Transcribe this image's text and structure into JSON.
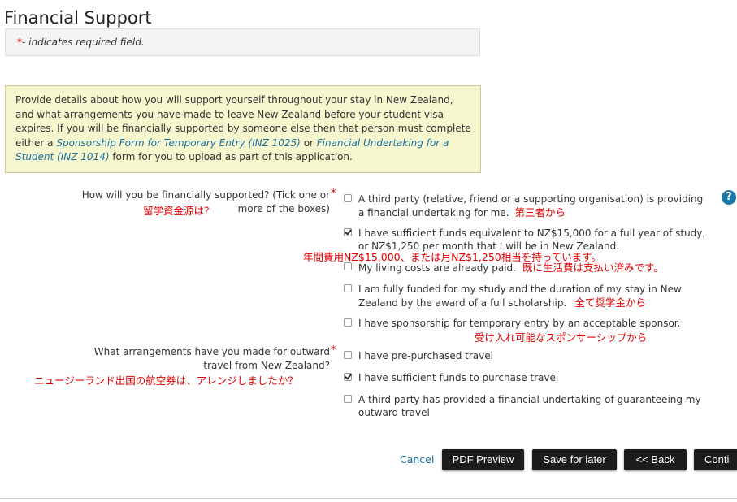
{
  "page": {
    "title": "Financial Support"
  },
  "required_note": {
    "star": "*",
    "text": "- indicates required field."
  },
  "info": {
    "text_before": "Provide details about how you will support yourself throughout your stay in New Zealand, and what arrangements you have made to leave New Zealand before your student visa expires. If you will be financially supported by someone else then that person must complete either a ",
    "link1": "Sponsorship Form for Temporary Entry (INZ 1025)",
    "text_mid": " or ",
    "link2": "Financial Undertaking for a Student (INZ 1014)",
    "text_after": " form for you to upload as part of this application."
  },
  "q1": {
    "label_line1": "How will you be financially supported? (Tick one or",
    "label_line2": "more of the boxes)",
    "star": "*",
    "annotation": "留学資金源は？",
    "options": [
      {
        "line1": "A third party (relative, friend or a supporting organisation) is providing",
        "line2": "a financial undertaking for me.",
        "checked": false,
        "annotation": "第三者から"
      },
      {
        "line1": "I have sufficient funds equivalent to NZ$15,000 for a full year of study,",
        "line2": "or NZ$1,250 per month that I will be in New Zealand.",
        "checked": true,
        "annotation": "年間費用NZ$15,000、または月NZ$1,250相当を持っています。"
      },
      {
        "line1": "My living costs are already paid.",
        "checked": false,
        "annotation": "既に生活費は支払い済みです。"
      },
      {
        "line1": "I am fully funded for my study and the duration of my stay in New",
        "line2": "Zealand by the award of a full scholarship.",
        "checked": false,
        "annotation": "全て奨学金から"
      },
      {
        "line1": "I have sponsorship for temporary entry by an acceptable sponsor.",
        "checked": false,
        "annotation": "受け入れ可能なスポンサーシップから"
      }
    ]
  },
  "q2": {
    "label_line1": "What arrangements have you made for outward",
    "label_line2": "travel from New Zealand?",
    "star": "*",
    "annotation": "ニュージーランド出国の航空券は、アレンジしましたか？",
    "options": [
      {
        "line1": "I have pre-purchased travel",
        "checked": false
      },
      {
        "line1": "I have sufficient funds to purchase travel",
        "checked": true
      },
      {
        "line1": "A third party has provided a financial undertaking of guaranteeing my",
        "line2": "outward travel",
        "checked": false
      }
    ]
  },
  "help": {
    "icon": "help-icon",
    "glyph": "?"
  },
  "actions": {
    "cancel": "Cancel",
    "pdf_preview": "PDF Preview",
    "save_later": "Save for later",
    "back": "<< Back",
    "continue": "Conti"
  }
}
